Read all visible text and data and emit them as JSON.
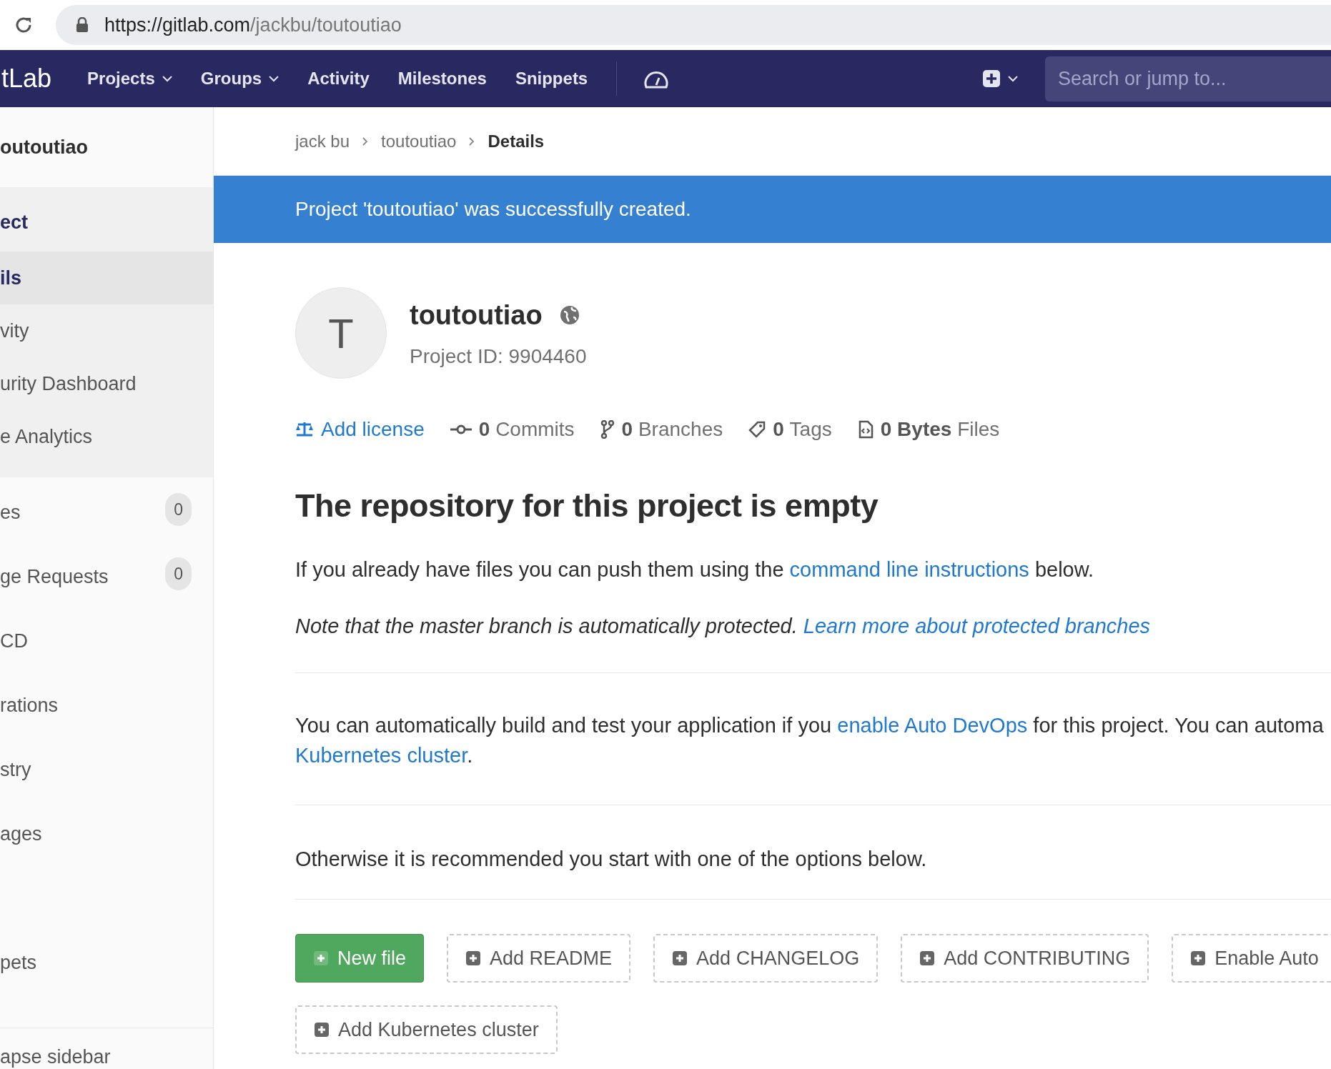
{
  "browser": {
    "url_host": "https://gitlab.com",
    "url_path": "/jackbu/toutoutiao"
  },
  "navbar": {
    "logo": "tLab",
    "items": [
      {
        "label": "Projects",
        "dropdown": true
      },
      {
        "label": "Groups",
        "dropdown": true
      },
      {
        "label": "Activity",
        "dropdown": false
      },
      {
        "label": "Milestones",
        "dropdown": false
      },
      {
        "label": "Snippets",
        "dropdown": false
      }
    ],
    "search": {
      "placeholder": "Search or jump to..."
    }
  },
  "sidebar": {
    "project_name": "outoutiao",
    "items": [
      {
        "label": "ect",
        "selected": true,
        "children": [
          {
            "label": "ils",
            "selected": true
          },
          {
            "label": "vity",
            "selected": false
          },
          {
            "label": "urity Dashboard",
            "selected": false
          },
          {
            "label": "e Analytics",
            "selected": false
          }
        ]
      },
      {
        "label": "es",
        "count": "0",
        "selected": false
      },
      {
        "label": "ge Requests",
        "count": "0",
        "selected": false
      },
      {
        "label": "CD",
        "selected": false
      },
      {
        "label": "rations",
        "selected": false
      },
      {
        "label": "stry",
        "selected": false
      },
      {
        "label": "ages",
        "selected": false
      },
      {
        "label": "pets",
        "selected": false
      }
    ],
    "collapse": "apse sidebar"
  },
  "breadcrumb": [
    {
      "label": "jack bu",
      "current": false
    },
    {
      "label": "toutoutiao",
      "current": false
    },
    {
      "label": "Details",
      "current": true
    }
  ],
  "flash": "Project 'toutoutiao' was successfully created.",
  "project": {
    "avatar_letter": "T",
    "name": "toutoutiao",
    "id_text": "Project ID: 9904460"
  },
  "stats": [
    {
      "kind": "license",
      "label": "Add license"
    },
    {
      "kind": "commits",
      "count": "0",
      "label": "Commits"
    },
    {
      "kind": "branches",
      "count": "0",
      "label": "Branches"
    },
    {
      "kind": "tags",
      "count": "0",
      "label": "Tags"
    },
    {
      "kind": "files",
      "count": "0 Bytes",
      "label": "Files"
    }
  ],
  "empty": {
    "heading": "The repository for this project is empty",
    "push_before": "If you already have files you can push them using the",
    "push_link": "command line instructions",
    "push_after": "below.",
    "note": "Note that the master branch is automatically protected.",
    "note_link": "Learn more about protected branches",
    "devops_before": "You can automatically build and test your application if you",
    "devops_link": "enable Auto DevOps",
    "devops_after": "for this project. You can automa",
    "devops_link2": "Kubernetes cluster",
    "devops_end": ".",
    "otherwise": "Otherwise it is recommended you start with one of the options below."
  },
  "buttons": [
    {
      "label": "New file",
      "kind": "primary"
    },
    {
      "label": "Add README",
      "kind": "dashed"
    },
    {
      "label": "Add CHANGELOG",
      "kind": "dashed"
    },
    {
      "label": "Add CONTRIBUTING",
      "kind": "dashed"
    },
    {
      "label": "Enable Auto",
      "kind": "dashed"
    },
    {
      "label": "Add Kubernetes cluster",
      "kind": "dashed"
    }
  ]
}
